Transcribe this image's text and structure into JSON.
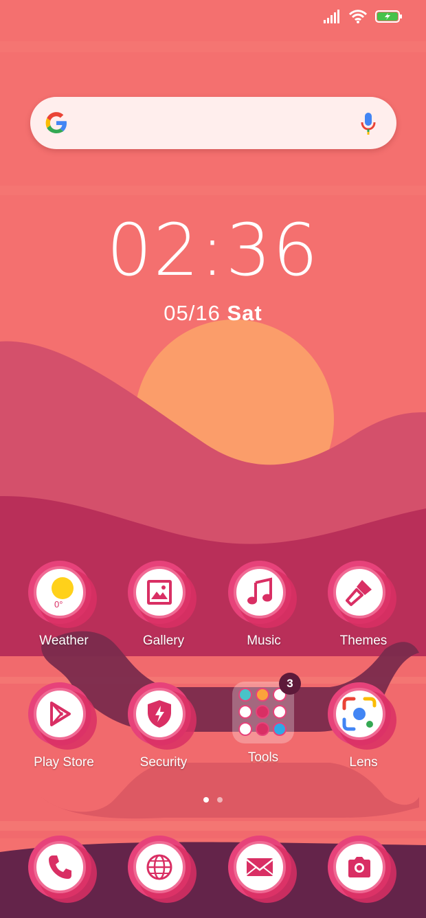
{
  "status_bar": {
    "signal_icon": "signal-icon",
    "wifi_icon": "wifi-icon",
    "battery_icon": "battery-charging-icon"
  },
  "search": {
    "logo": "google-logo",
    "mic": "mic-icon"
  },
  "clock": {
    "time": "02:36",
    "date": "05/16",
    "day": "Sat"
  },
  "apps_row1": [
    {
      "label": "Weather",
      "temp": "0°"
    },
    {
      "label": "Gallery"
    },
    {
      "label": "Music"
    },
    {
      "label": "Themes"
    }
  ],
  "apps_row2": [
    {
      "label": "Play Store"
    },
    {
      "label": "Security"
    },
    {
      "label": "Tools",
      "badge": "3"
    },
    {
      "label": "Lens"
    }
  ],
  "dock": [
    {
      "name": "phone-icon"
    },
    {
      "name": "browser-icon"
    },
    {
      "name": "messages-icon"
    },
    {
      "name": "camera-icon"
    }
  ],
  "colors": {
    "accent": "#d92f64",
    "sky": "#f4706f",
    "sun": "#fb9d6a",
    "hill": "#d4506b",
    "ground": "#64244a"
  }
}
